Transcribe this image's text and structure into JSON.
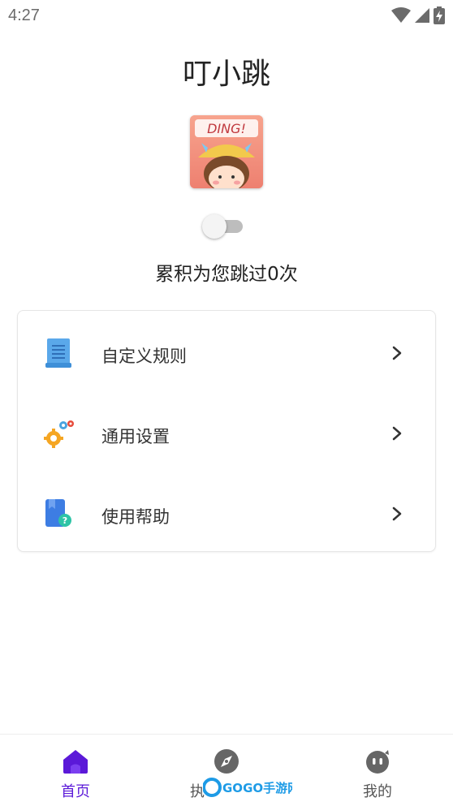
{
  "status_bar": {
    "time": "4:27",
    "icons": [
      "wifi-icon",
      "signal-icon",
      "battery-charging-icon"
    ]
  },
  "app": {
    "title": "叮小跳",
    "logo_text": "DING!",
    "skip_count_text": "累积为您跳过0次",
    "service_enabled": false
  },
  "menu": {
    "items": [
      {
        "label": "自定义规则",
        "icon": "rules-document-icon"
      },
      {
        "label": "通用设置",
        "icon": "gears-icon"
      },
      {
        "label": "使用帮助",
        "icon": "help-book-icon"
      }
    ]
  },
  "bottom_nav": {
    "items": [
      {
        "label": "首页",
        "icon": "home-icon",
        "active": true
      },
      {
        "label": "执",
        "icon": "compass-icon",
        "active": false
      },
      {
        "label": "我的",
        "icon": "face-icon",
        "active": false
      }
    ]
  },
  "watermark": {
    "text": "GOGO手游网"
  },
  "colors": {
    "accent": "#5b19d8",
    "text_primary": "#222222",
    "toggle_track": "#bdbdbd",
    "icon_gray": "#666666"
  }
}
